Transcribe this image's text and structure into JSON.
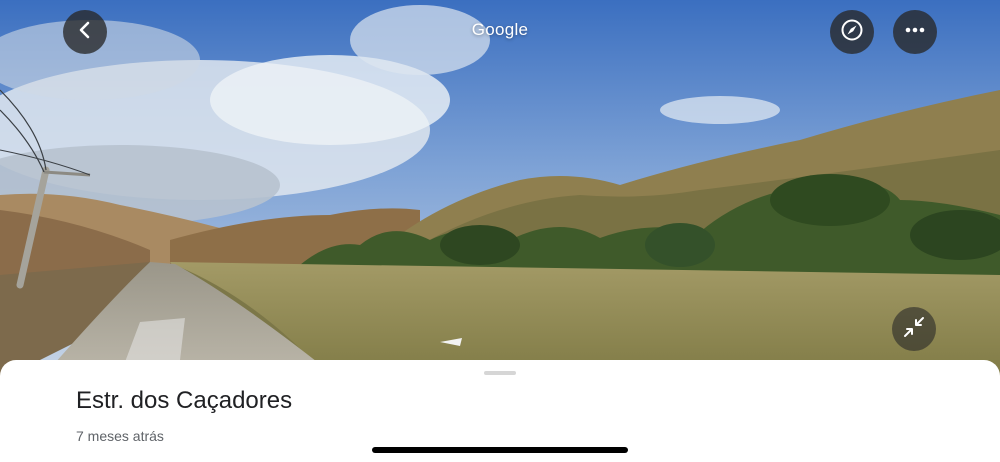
{
  "header": {
    "title": "Google"
  },
  "icons": {
    "back": "back-arrow-icon",
    "compass": "compass-icon",
    "more": "more-options-icon",
    "collapse": "collapse-arrows-icon"
  },
  "place": {
    "name": "Estr. dos Caçadores",
    "date": "7 meses atrás"
  },
  "colors": {
    "sheet_background": "#ffffff",
    "button_background": "#282828",
    "title_text": "#202124",
    "secondary_text": "#5f6368"
  }
}
